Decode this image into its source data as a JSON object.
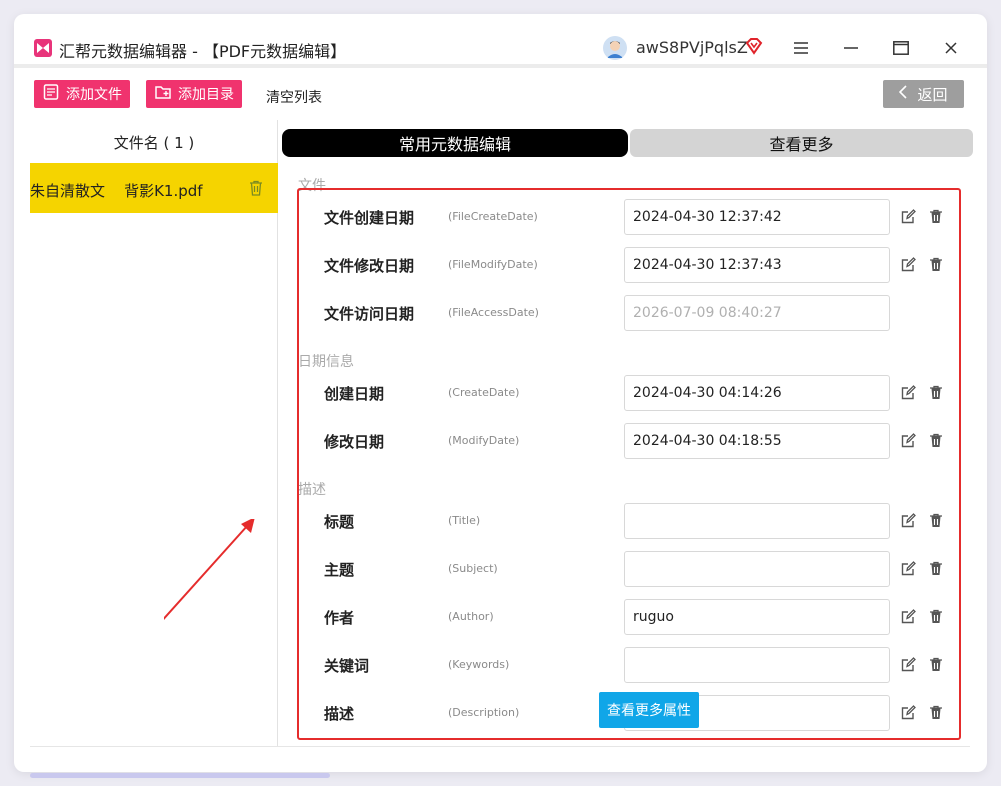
{
  "window": {
    "title": "汇帮元数据编辑器 - 【PDF元数据编辑】",
    "username": "awS8PVjPqlsZ"
  },
  "toolbar": {
    "add_file_label": "添加文件",
    "add_dir_label": "添加目录",
    "clear_list_label": "清空列表",
    "back_label": "返回"
  },
  "file_list": {
    "header": "文件名 ( 1 )",
    "items": [
      {
        "name": "朱自清散文    背影K1.pdf"
      }
    ]
  },
  "tabs": {
    "common": "常用元数据编辑",
    "more": "查看更多"
  },
  "sections": {
    "file": "文件",
    "date": "日期信息",
    "desc": "描述"
  },
  "fields": [
    {
      "label": "文件创建日期",
      "key": "(FileCreateDate)",
      "value": "2024-04-30 12:37:42"
    },
    {
      "label": "文件修改日期",
      "key": "(FileModifyDate)",
      "value": "2024-04-30 12:37:43"
    },
    {
      "label": "文件访问日期",
      "key": "(FileAccessDate)",
      "value": "2026-07-09 08:40:27"
    },
    {
      "label": "创建日期",
      "key": "(CreateDate)",
      "value": "2024-04-30 04:14:26"
    },
    {
      "label": "修改日期",
      "key": "(ModifyDate)",
      "value": "2024-04-30 04:18:55"
    },
    {
      "label": "标题",
      "key": "(Title)",
      "value": ""
    },
    {
      "label": "主题",
      "key": "(Subject)",
      "value": ""
    },
    {
      "label": "作者",
      "key": "(Author)",
      "value": "ruguo"
    },
    {
      "label": "关键词",
      "key": "(Keywords)",
      "value": ""
    },
    {
      "label": "描述",
      "key": "(Description)",
      "value": ""
    }
  ],
  "more_props_label": "查看更多属性",
  "colors": {
    "accent_pink": "#f0336e",
    "highlight_yellow": "#f5d400",
    "annotation_red": "#e52c2c",
    "more_blue": "#10a6e8"
  },
  "icons": [
    "app-logo-icon",
    "avatar",
    "vip-diamond-icon",
    "menu-icon",
    "minimize-icon",
    "maximize-icon",
    "close-icon",
    "add-file-icon",
    "add-folder-icon",
    "chevron-left-icon",
    "trash-icon",
    "edit-icon"
  ]
}
